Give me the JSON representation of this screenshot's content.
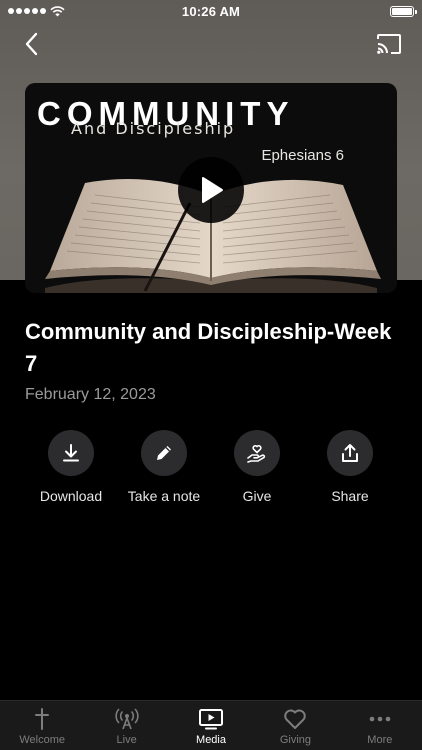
{
  "status_bar": {
    "time": "10:26 AM"
  },
  "artwork": {
    "title": "COMMUNITY",
    "subtitle": "And Discipleship",
    "verse": "Ephesians 6"
  },
  "media": {
    "title": "Community and Discipleship-Week 7",
    "date": "February 12, 2023"
  },
  "actions": [
    {
      "label": "Download",
      "icon": "download-icon"
    },
    {
      "label": "Take a note",
      "icon": "pencil-icon"
    },
    {
      "label": "Give",
      "icon": "hand-heart-icon"
    },
    {
      "label": "Share",
      "icon": "share-icon"
    }
  ],
  "tabs": [
    {
      "label": "Welcome",
      "icon": "cross-icon",
      "active": false
    },
    {
      "label": "Live",
      "icon": "broadcast-icon",
      "active": false
    },
    {
      "label": "Media",
      "icon": "play-screen-icon",
      "active": true
    },
    {
      "label": "Giving",
      "icon": "heart-icon",
      "active": false
    },
    {
      "label": "More",
      "icon": "more-dots-icon",
      "active": false
    }
  ],
  "colors": {
    "background": "#000000",
    "hero_background": "#67635e",
    "action_circle": "#2c2c2e",
    "tab_bar": "#1a1a1a",
    "tab_inactive": "#7d7d7d",
    "tab_active": "#ffffff",
    "date_text": "#9a9a9a"
  }
}
